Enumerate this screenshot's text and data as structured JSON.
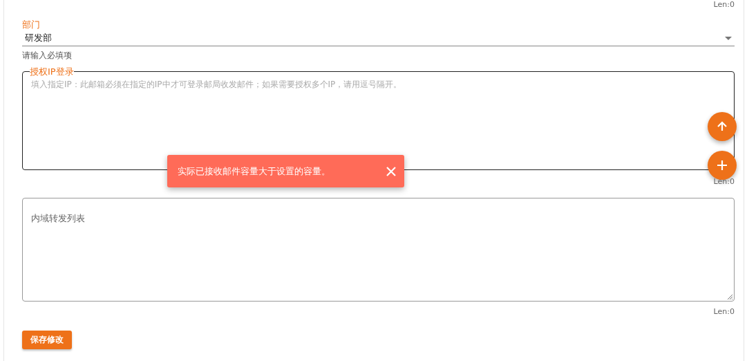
{
  "top_counter": "Len:0",
  "department": {
    "label": "部门",
    "value": "研发部",
    "helper": "请输入必填项"
  },
  "auth_ip": {
    "label": "授权IP登录",
    "placeholder": "填入指定IP：此邮箱必须在指定的IP中才可登录邮局收发邮件；如果需要授权多个IP，请用逗号隔开。",
    "counter": "Len:0"
  },
  "forward_list": {
    "placeholder": "内域转发列表",
    "counter": "Len:0"
  },
  "save_button": "保存修改",
  "toast": {
    "message": "实际已接收邮件容量大于设置的容量。"
  },
  "fabs": [
    {
      "kind": "up"
    },
    {
      "kind": "add"
    }
  ]
}
